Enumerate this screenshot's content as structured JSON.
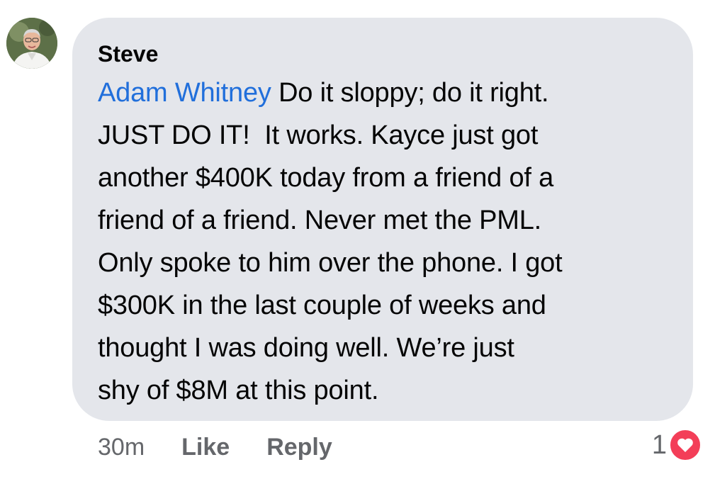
{
  "comment": {
    "author": "Steve",
    "mention": "Adam Whitney",
    "lines": [
      "Do it sloppy; do it right.",
      "JUST DO IT!  It works. Kayce just got",
      "another $400K today from a friend of a",
      "friend of a friend. Never met the PML.",
      "Only spoke to him over the phone. I got",
      "$300K in the last couple of weeks and",
      "thought I was doing well. We’re just",
      "shy of $8M at this point."
    ],
    "timestamp": "30m",
    "like_label": "Like",
    "reply_label": "Reply",
    "reaction_count": "1",
    "reaction_icon": "heart-icon"
  },
  "colors": {
    "bubble": "#e4e6eb",
    "mention": "#216fdb",
    "meta": "#65676b",
    "love": "#f33e58"
  }
}
